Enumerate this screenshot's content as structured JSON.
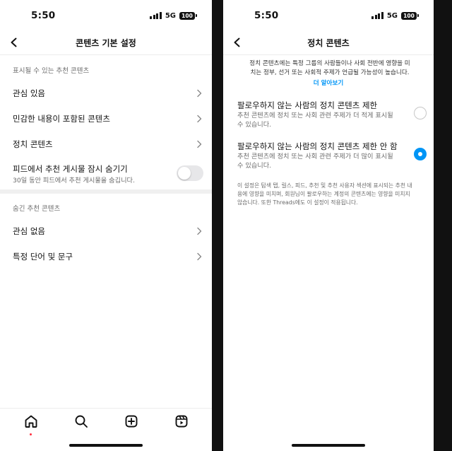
{
  "left": {
    "status": {
      "time": "5:50",
      "network": "5G",
      "battery": "100"
    },
    "nav": {
      "title": "콘텐츠 기본 설정"
    },
    "section1": {
      "header": "표시될 수 있는 추천 콘텐츠"
    },
    "items": [
      {
        "label": "관심 있음"
      },
      {
        "label": "민감한 내용이 포함된 콘텐츠"
      },
      {
        "label": "정치 콘텐츠"
      }
    ],
    "toggle": {
      "title": "피드에서 추천 게시물 잠시 숨기기",
      "subtitle": "30일 동안 피드에서 추천 게시물을 숨깁니다.",
      "on": false
    },
    "section2": {
      "header": "숨긴 추천 콘텐츠"
    },
    "hidden_items": [
      {
        "label": "관심 없음"
      },
      {
        "label": "특정 단어 및 문구"
      }
    ],
    "tabbar": {
      "icons": [
        "home-icon",
        "search-icon",
        "create-icon",
        "reels-icon"
      ],
      "active": "home-icon"
    }
  },
  "right": {
    "status": {
      "time": "5:50",
      "network": "5G",
      "battery": "100"
    },
    "nav": {
      "title": "정치 콘텐츠"
    },
    "intro_line1": "정치 콘텐츠에는 특정 그룹의 사람들이나 사회 전반에 영향을 미",
    "intro_line2": "치는 정부, 선거 또는 사회적 주제가 언급될 가능성이 높습니다.",
    "learn_more": "더 알아보기",
    "options": [
      {
        "title": "팔로우하지 않는 사람의 정치 콘텐츠 제한",
        "desc_line1": "추천 콘텐츠에 정치 또는 사회 관련 주제가 더 적게 표시될",
        "desc_line2": "수 있습니다.",
        "selected": false
      },
      {
        "title": "팔로우하지 않는 사람의 정치 콘텐츠 제한 안 함",
        "desc_line1": "추천 콘텐츠에 정치 또는 사회 관련 주제가 더 많이 표시될",
        "desc_line2": "수 있습니다.",
        "selected": true
      }
    ],
    "note_line1": "이 설정은 탐색 탭, 릴스, 피드, 추천 및 추천 사용자 섹션에 표시되는 추천 내",
    "note_line2": "용에 영향을 미치며, 회원님이 팔로우하는 계정의 콘텐츠에는 영향을 미치지",
    "note_line3": "않습니다. 또한 Threads에도 이 설정이 적용됩니다."
  },
  "colors": {
    "accent": "#0095f6",
    "notification_dot": "#ff3040",
    "secondary_text": "#6b6b6b",
    "toggle_off": "#e7e7e9"
  }
}
